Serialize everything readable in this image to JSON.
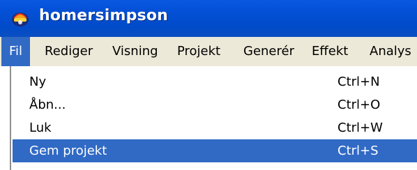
{
  "window": {
    "title": "homersimpson",
    "icon": "app-logo-icon"
  },
  "menubar": {
    "items": [
      {
        "label": "Fil",
        "active": true
      },
      {
        "label": "Rediger"
      },
      {
        "label": "Visning"
      },
      {
        "label": "Projekt"
      },
      {
        "label": "Generér"
      },
      {
        "label": "Effekt"
      },
      {
        "label": "Analys"
      }
    ]
  },
  "file_menu": {
    "items": [
      {
        "label": "Ny",
        "shortcut": "Ctrl+N"
      },
      {
        "label": "Åbn...",
        "shortcut": "Ctrl+O"
      },
      {
        "label": "Luk",
        "shortcut": "Ctrl+W"
      },
      {
        "label": "Gem projekt",
        "shortcut": "Ctrl+S",
        "highlighted": true
      }
    ]
  },
  "colors": {
    "titlebar": "#0350d6",
    "menubar": "#ece9d8",
    "highlight": "#316ac5"
  }
}
